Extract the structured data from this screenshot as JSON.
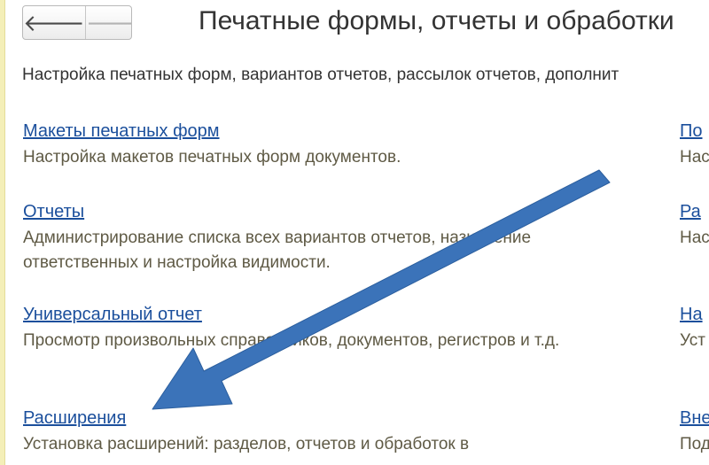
{
  "navigation": {
    "back_glyph": "🡐",
    "forward_glyph": "🡒"
  },
  "page": {
    "title": "Печатные формы, отчеты и обработки",
    "description": "Настройка печатных форм, вариантов отчетов, рассылок отчетов, дополнит"
  },
  "left_items": [
    {
      "link": "Макеты печатных форм",
      "description": "Настройка макетов печатных форм документов."
    },
    {
      "link": "Отчеты",
      "description": "Администрирование списка всех вариантов отчетов, назначение\nответственных и настройка видимости."
    },
    {
      "link": "Универсальный отчет",
      "description": "Просмотр произвольных справочников, документов, регистров и т.д."
    },
    {
      "link": "Расширения",
      "description": "Установка расширений: разделов, отчетов и обработок в"
    }
  ],
  "right_items": [
    {
      "link": "По",
      "description": "Нас"
    },
    {
      "link": "Ра",
      "description": "Нас\nтре"
    },
    {
      "link": "На",
      "description": "Уст\nотч"
    },
    {
      "link": "Вне",
      "description": "Под"
    }
  ],
  "colors": {
    "link": "#1b4f9c",
    "arrow": "#3b73b9"
  }
}
